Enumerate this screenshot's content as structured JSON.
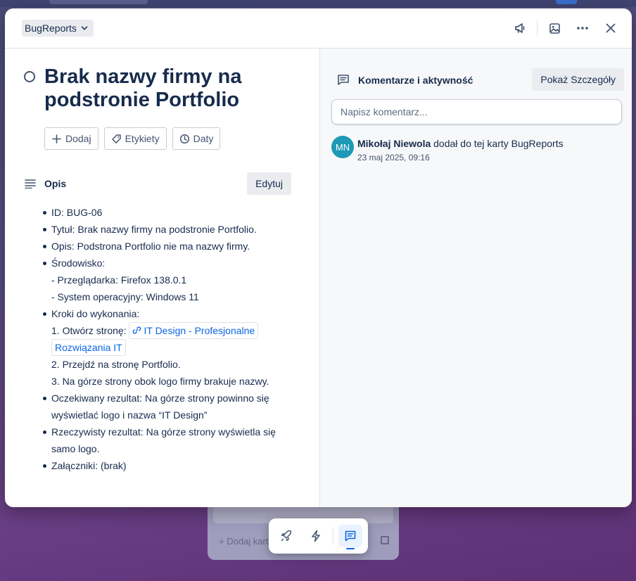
{
  "header": {
    "list_name": "BugReports",
    "icons": [
      "megaphone-icon",
      "image-icon",
      "more-icon",
      "close-icon"
    ]
  },
  "card": {
    "title": "Brak nazwy firmy na podstronie Portfolio",
    "actions": [
      {
        "label": "Dodaj",
        "icon": "plus-icon"
      },
      {
        "label": "Etykiety",
        "icon": "tag-icon"
      },
      {
        "label": "Daty",
        "icon": "clock-icon"
      }
    ]
  },
  "description": {
    "heading": "Opis",
    "edit_label": "Edytuj",
    "id_line": "ID: BUG-06",
    "title_line": "Tytuł: Brak nazwy firmy na podstronie Portfolio.",
    "desc_line": "Opis: Podstrona Portfolio nie ma nazwy firmy.",
    "env_line": "Środowisko:",
    "env_browser": "- Przeglądarka: Firefox 138.0.1",
    "env_os": "- System operacyjny: Windows 11",
    "steps_line": "Kroki do wykonania:",
    "step1_prefix": "1. Otwórz stronę:",
    "step1_link": "IT Design - Profesjonalne Rozwiązania IT",
    "step2": "2. Przejdź na stronę Portfolio.",
    "step3": "3. Na górze strony obok logo firmy brakuje nazwy.",
    "expected": "Oczekiwany rezultat: Na górze strony powinno się wyświetlać logo i nazwa “IT Design”",
    "actual": "Rzeczywisty rezultat: Na górze strony wyświetla się samo logo.",
    "attachments": "Załączniki: (brak)"
  },
  "activity": {
    "heading": "Komentarze i aktywność",
    "details_label": "Pokaż Szczegóły",
    "comment_placeholder": "Napisz komentarz...",
    "entries": [
      {
        "initials": "MN",
        "user": "Mikołaj Niewola",
        "action": "dodał do tej karty BugReports",
        "time": "23 maj 2025, 09:16",
        "avatar_color": "#1d9ab5"
      }
    ]
  },
  "background": {
    "card_add_label": "Dodaj kartę"
  },
  "dock": {
    "items": [
      "rocket-icon",
      "lightning-icon",
      "comment-icon"
    ],
    "active": "comment-icon"
  },
  "colors": {
    "accent": "#0c66e4",
    "text": "#172b4d",
    "subtle": "#44546f"
  }
}
